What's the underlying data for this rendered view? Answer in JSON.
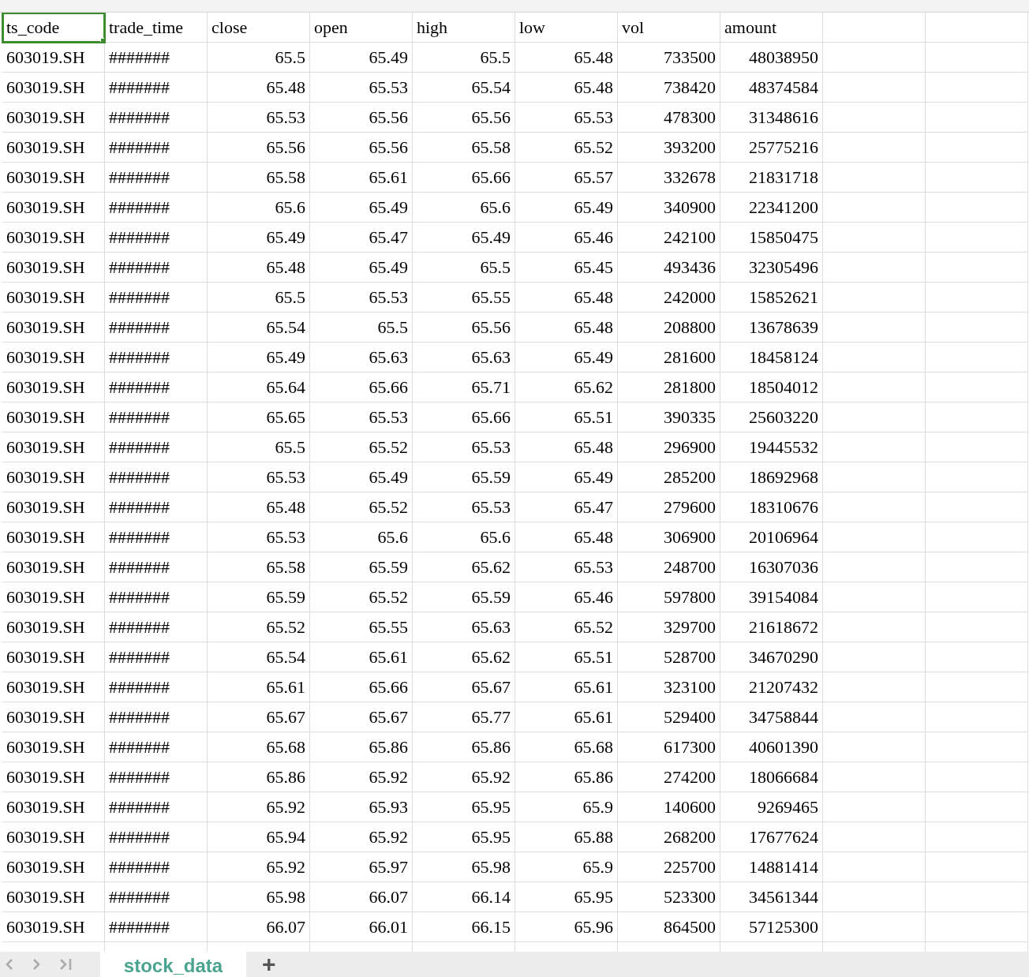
{
  "header": [
    {
      "text": "ts_code",
      "selected": true
    },
    {
      "text": "trade_time",
      "selected": false
    },
    {
      "text": "close",
      "selected": false
    },
    {
      "text": "open",
      "selected": false
    },
    {
      "text": "high",
      "selected": false
    },
    {
      "text": "low",
      "selected": false
    },
    {
      "text": "vol",
      "selected": false
    },
    {
      "text": "amount",
      "selected": false
    }
  ],
  "rows": [
    [
      "603019.SH",
      "#######",
      "65.5",
      "65.49",
      "65.5",
      "65.48",
      "733500",
      "48038950"
    ],
    [
      "603019.SH",
      "#######",
      "65.48",
      "65.53",
      "65.54",
      "65.48",
      "738420",
      "48374584"
    ],
    [
      "603019.SH",
      "#######",
      "65.53",
      "65.56",
      "65.56",
      "65.53",
      "478300",
      "31348616"
    ],
    [
      "603019.SH",
      "#######",
      "65.56",
      "65.56",
      "65.58",
      "65.52",
      "393200",
      "25775216"
    ],
    [
      "603019.SH",
      "#######",
      "65.58",
      "65.61",
      "65.66",
      "65.57",
      "332678",
      "21831718"
    ],
    [
      "603019.SH",
      "#######",
      "65.6",
      "65.49",
      "65.6",
      "65.49",
      "340900",
      "22341200"
    ],
    [
      "603019.SH",
      "#######",
      "65.49",
      "65.47",
      "65.49",
      "65.46",
      "242100",
      "15850475"
    ],
    [
      "603019.SH",
      "#######",
      "65.48",
      "65.49",
      "65.5",
      "65.45",
      "493436",
      "32305496"
    ],
    [
      "603019.SH",
      "#######",
      "65.5",
      "65.53",
      "65.55",
      "65.48",
      "242000",
      "15852621"
    ],
    [
      "603019.SH",
      "#######",
      "65.54",
      "65.5",
      "65.56",
      "65.48",
      "208800",
      "13678639"
    ],
    [
      "603019.SH",
      "#######",
      "65.49",
      "65.63",
      "65.63",
      "65.49",
      "281600",
      "18458124"
    ],
    [
      "603019.SH",
      "#######",
      "65.64",
      "65.66",
      "65.71",
      "65.62",
      "281800",
      "18504012"
    ],
    [
      "603019.SH",
      "#######",
      "65.65",
      "65.53",
      "65.66",
      "65.51",
      "390335",
      "25603220"
    ],
    [
      "603019.SH",
      "#######",
      "65.5",
      "65.52",
      "65.53",
      "65.48",
      "296900",
      "19445532"
    ],
    [
      "603019.SH",
      "#######",
      "65.53",
      "65.49",
      "65.59",
      "65.49",
      "285200",
      "18692968"
    ],
    [
      "603019.SH",
      "#######",
      "65.48",
      "65.52",
      "65.53",
      "65.47",
      "279600",
      "18310676"
    ],
    [
      "603019.SH",
      "#######",
      "65.53",
      "65.6",
      "65.6",
      "65.48",
      "306900",
      "20106964"
    ],
    [
      "603019.SH",
      "#######",
      "65.58",
      "65.59",
      "65.62",
      "65.53",
      "248700",
      "16307036"
    ],
    [
      "603019.SH",
      "#######",
      "65.59",
      "65.52",
      "65.59",
      "65.46",
      "597800",
      "39154084"
    ],
    [
      "603019.SH",
      "#######",
      "65.52",
      "65.55",
      "65.63",
      "65.52",
      "329700",
      "21618672"
    ],
    [
      "603019.SH",
      "#######",
      "65.54",
      "65.61",
      "65.62",
      "65.51",
      "528700",
      "34670290"
    ],
    [
      "603019.SH",
      "#######",
      "65.61",
      "65.66",
      "65.67",
      "65.61",
      "323100",
      "21207432"
    ],
    [
      "603019.SH",
      "#######",
      "65.67",
      "65.67",
      "65.77",
      "65.61",
      "529400",
      "34758844"
    ],
    [
      "603019.SH",
      "#######",
      "65.68",
      "65.86",
      "65.86",
      "65.68",
      "617300",
      "40601390"
    ],
    [
      "603019.SH",
      "#######",
      "65.86",
      "65.92",
      "65.92",
      "65.86",
      "274200",
      "18066684"
    ],
    [
      "603019.SH",
      "#######",
      "65.92",
      "65.93",
      "65.95",
      "65.9",
      "140600",
      "9269465"
    ],
    [
      "603019.SH",
      "#######",
      "65.94",
      "65.92",
      "65.95",
      "65.88",
      "268200",
      "17677624"
    ],
    [
      "603019.SH",
      "#######",
      "65.92",
      "65.97",
      "65.98",
      "65.9",
      "225700",
      "14881414"
    ],
    [
      "603019.SH",
      "#######",
      "65.98",
      "66.07",
      "66.14",
      "65.95",
      "523300",
      "34561344"
    ],
    [
      "603019.SH",
      "#######",
      "66.07",
      "66.01",
      "66.15",
      "65.96",
      "864500",
      "57125300"
    ]
  ],
  "sheet_tabs": [
    {
      "label": "stock_data",
      "selected": true
    }
  ],
  "add_sheet": "+"
}
